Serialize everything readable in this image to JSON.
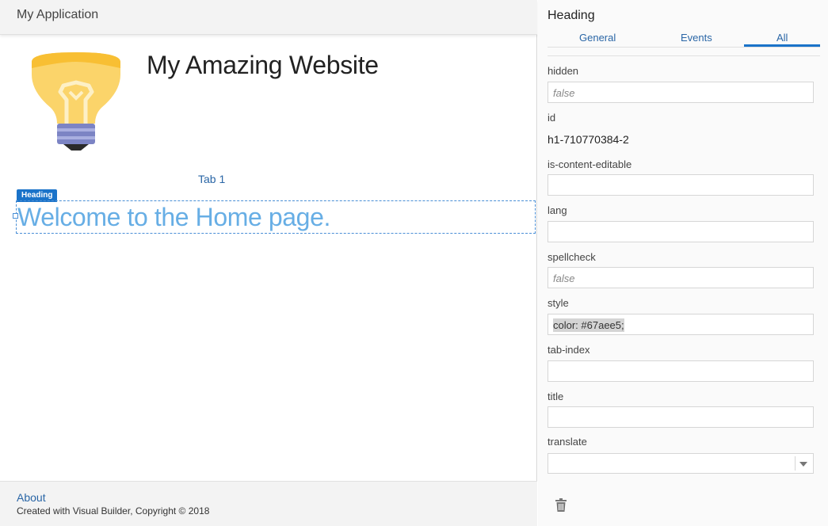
{
  "app": {
    "title": "My Application"
  },
  "page": {
    "site_title": "My Amazing Website",
    "tab_label": "Tab 1",
    "selection_tag": "Heading",
    "heading_text": "Welcome to the Home page.",
    "heading_color": "#67aee5",
    "logo_icon": "lightbulb-icon"
  },
  "footer": {
    "link": "About",
    "copyright": "Created with Visual Builder, Copyright © 2018"
  },
  "panel": {
    "title": "Heading",
    "tabs": [
      {
        "label": "General",
        "active": false
      },
      {
        "label": "Events",
        "active": false
      },
      {
        "label": "All",
        "active": true
      }
    ],
    "properties": {
      "hidden": {
        "label": "hidden",
        "placeholder": "false",
        "value": ""
      },
      "id": {
        "label": "id",
        "value": "h1-710770384-2"
      },
      "is_content_editable": {
        "label": "is-content-editable",
        "value": ""
      },
      "lang": {
        "label": "lang",
        "value": ""
      },
      "spellcheck": {
        "label": "spellcheck",
        "placeholder": "false",
        "value": ""
      },
      "style": {
        "label": "style",
        "value": "color: #67aee5;"
      },
      "tab_index": {
        "label": "tab-index",
        "value": ""
      },
      "title": {
        "label": "title",
        "value": ""
      },
      "translate": {
        "label": "translate",
        "value": ""
      }
    },
    "delete_icon": "trash-icon"
  },
  "colors": {
    "accent": "#1a73c9",
    "link": "#2a66a6",
    "bulb_yellow": "#fbd46a",
    "bulb_base": "#7c84c4"
  }
}
